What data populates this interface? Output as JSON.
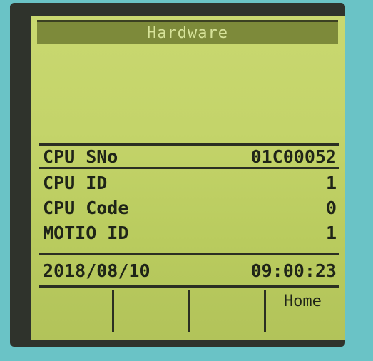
{
  "title": "Hardware",
  "header_row": {
    "label": "CPU SNo",
    "value": "01C00052"
  },
  "info_rows": [
    {
      "label": "CPU ID",
      "value": "1"
    },
    {
      "label": "CPU Code",
      "value": "0"
    },
    {
      "label": "MOTIO ID",
      "value": "1"
    }
  ],
  "datetime": {
    "date": "2018/08/10",
    "time": "09:00:23"
  },
  "softkeys": [
    "",
    "",
    "",
    "Home"
  ]
}
